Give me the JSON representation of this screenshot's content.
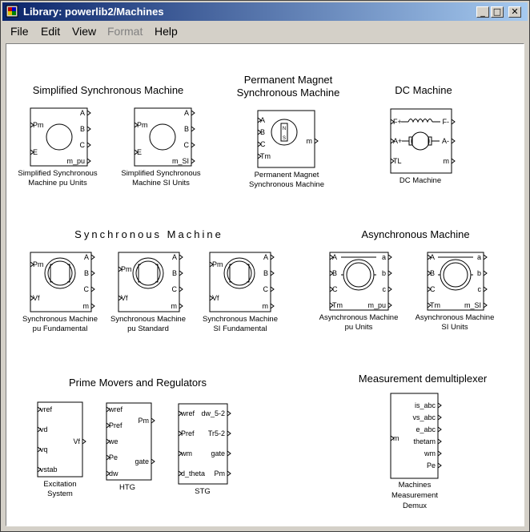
{
  "window": {
    "title": "Library: powerlib2/Machines"
  },
  "menu": [
    "File",
    "Edit",
    "View",
    "Format",
    "Help"
  ],
  "titlebar_buttons": {
    "minimize": "_",
    "maximize": "□",
    "close": "✕"
  },
  "sections": {
    "simplified": "Simplified Synchronous Machine",
    "pm_line1": "Permanent Magnet",
    "pm_line2": "Synchronous Machine",
    "dc": "DC Machine",
    "sync": "Synchronous Machine",
    "async": "Asynchronous Machine",
    "prime": "Prime Movers and Regulators",
    "meas": "Measurement demultiplexer"
  },
  "blocks": {
    "ssm_pu": {
      "in": [
        "Pm",
        "E"
      ],
      "out": [
        "A",
        "B",
        "C",
        "m_pu"
      ],
      "caption": [
        "Simplified Synchronous",
        "Machine  pu Units"
      ]
    },
    "ssm_si": {
      "in": [
        "Pm",
        "E"
      ],
      "out": [
        "A",
        "B",
        "C",
        "m_SI"
      ],
      "caption": [
        "Simplified Synchronous",
        "Machine SI Units"
      ]
    },
    "pmsm": {
      "in": [
        "A",
        "B",
        "C",
        "Tm"
      ],
      "out": [
        "m"
      ],
      "symbol": [
        "N",
        "S"
      ],
      "caption": [
        "Permanent Magnet",
        "Synchronous Machine"
      ]
    },
    "dc": {
      "in": [
        "F+",
        "A+",
        "TL"
      ],
      "out": [
        "F-",
        "A-",
        "m"
      ],
      "caption": [
        "DC Machine"
      ]
    },
    "sm_pu_fund": {
      "in": [
        "Pm",
        "Vf"
      ],
      "out": [
        "A",
        "B",
        "C",
        "m"
      ],
      "caption": [
        "Synchronous Machine",
        "pu Fundamental"
      ]
    },
    "sm_pu_std": {
      "in": [
        "Pm",
        "Vf"
      ],
      "out": [
        "A",
        "B",
        "C",
        "m"
      ],
      "caption": [
        "Synchronous Machine",
        "pu Standard"
      ]
    },
    "sm_si_fund": {
      "in": [
        "Pm",
        "Vf"
      ],
      "out": [
        "A",
        "B",
        "C",
        "m"
      ],
      "caption": [
        "Synchronous Machine",
        "SI Fundamental"
      ]
    },
    "am_pu": {
      "in": [
        "A",
        "B",
        "C",
        "Tm"
      ],
      "out": [
        "a",
        "b",
        "c",
        "m_pu"
      ],
      "caption": [
        "Asynchronous Machine",
        "pu Units"
      ]
    },
    "am_si": {
      "in": [
        "A",
        "B",
        "C",
        "Tm"
      ],
      "out": [
        "a",
        "b",
        "c",
        "m_SI"
      ],
      "caption": [
        "Asynchronous Machine",
        "SI Units"
      ]
    },
    "exc": {
      "in": [
        "vref",
        "vd",
        "vq",
        "vstab"
      ],
      "out": [
        "Vf"
      ],
      "caption": [
        "Excitation",
        "System"
      ]
    },
    "htg": {
      "in": [
        "wref",
        "Pref",
        "we",
        "Pe",
        "dw"
      ],
      "out": [
        "Pm",
        "gate"
      ],
      "caption": [
        "HTG"
      ]
    },
    "stg": {
      "in": [
        "wref",
        "Pref",
        "wm",
        "d_theta"
      ],
      "out": [
        "dw_5-2",
        "Tr5-2",
        "gate",
        "Pm"
      ],
      "caption": [
        "STG"
      ]
    },
    "demux": {
      "in": [
        "m"
      ],
      "out": [
        "is_abc",
        "vs_abc",
        "e_abc",
        "thetam",
        "wm",
        "Pe"
      ],
      "caption": [
        "Machines",
        "Measurement",
        "Demux"
      ]
    }
  }
}
